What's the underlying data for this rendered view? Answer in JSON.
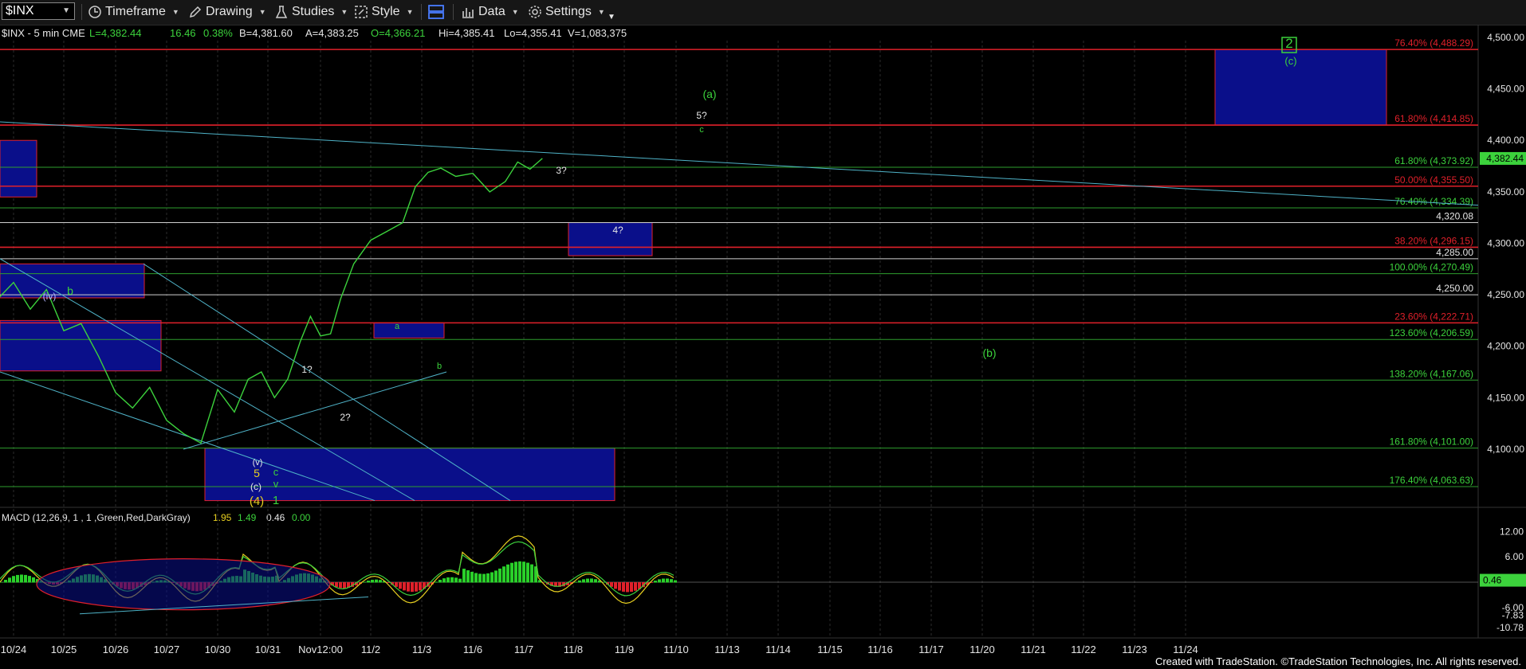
{
  "toolbar": {
    "symbol": "$INX",
    "timeframe": "Timeframe",
    "drawing": "Drawing",
    "studies": "Studies",
    "style": "Style",
    "data": "Data",
    "settings": "Settings"
  },
  "status_line": {
    "name": "$INX - 5 min  CME",
    "last": "L=4,382.44",
    "change": "16.46",
    "change_pct": "0.38%",
    "bid": "B=4,381.60",
    "ask": "A=4,383.25",
    "open": "O=4,366.21",
    "high": "Hi=4,385.41",
    "low": "Lo=4,355.41",
    "volume": "V=1,083,375"
  },
  "macd_legend": {
    "name": "MACD (12,26,9, 1 , 1 ,Green,Red,DarkGray)",
    "v1": "1.95",
    "v2": "1.49",
    "v3": "0.46",
    "v4": "0.00"
  },
  "footer": "Created with TradeStation. ©TradeStation Technologies, Inc. All rights reserved.",
  "chart_data": {
    "type": "line",
    "title": "$INX - 5 min",
    "price_axis": {
      "min": 4050,
      "max": 4500,
      "ticks": [
        "4,100.00",
        "4,150.00",
        "4,200.00",
        "4,250.00",
        "4,300.00",
        "4,350.00",
        "4,400.00",
        "4,450.00",
        "4,500.00"
      ]
    },
    "last_price": "4,382.44",
    "x_labels": [
      "10/24",
      "10/25",
      "10/26",
      "10/27",
      "10/30",
      "10/31",
      "Nov12:00",
      "11/2",
      "11/3",
      "11/6",
      "11/7",
      "11/8",
      "11/9",
      "11/10",
      "11/13",
      "11/14",
      "11/15",
      "11/16",
      "11/17",
      "11/20",
      "11/21",
      "11/22",
      "11/23",
      "11/24"
    ],
    "price_series": [
      [
        "10/24",
        4245
      ],
      [
        "10/24",
        4262
      ],
      [
        "10/24",
        4236
      ],
      [
        "10/25",
        4255
      ],
      [
        "10/25",
        4215
      ],
      [
        "10/25",
        4222
      ],
      [
        "10/26",
        4190
      ],
      [
        "10/26",
        4155
      ],
      [
        "10/26",
        4140
      ],
      [
        "10/27",
        4160
      ],
      [
        "10/27",
        4128
      ],
      [
        "10/27",
        4115
      ],
      [
        "10/30",
        4106
      ],
      [
        "10/30",
        4158
      ],
      [
        "10/30",
        4136
      ],
      [
        "10/31",
        4168
      ],
      [
        "10/31",
        4175
      ],
      [
        "10/31",
        4150
      ],
      [
        "10/31",
        4168
      ],
      [
        "Nov12:00",
        4205
      ],
      [
        "Nov12:00",
        4229
      ],
      [
        "Nov12:00",
        4210
      ],
      [
        "Nov12:00",
        4212
      ],
      [
        "Nov12:00",
        4246
      ],
      [
        "11/2",
        4280
      ],
      [
        "11/2",
        4303
      ],
      [
        "11/2",
        4312
      ],
      [
        "11/3",
        4320
      ],
      [
        "11/3",
        4355
      ],
      [
        "11/3",
        4369
      ],
      [
        "11/3",
        4373
      ],
      [
        "11/6",
        4365
      ],
      [
        "11/6",
        4368
      ],
      [
        "11/6",
        4350
      ],
      [
        "11/7",
        4360
      ],
      [
        "11/7",
        4379
      ],
      [
        "11/7",
        4372
      ],
      [
        "11/7",
        4382.44
      ]
    ],
    "levels": [
      {
        "label": "76.40% (4,488.29)",
        "price": 4488.29,
        "color": "#e0202a",
        "line": "red"
      },
      {
        "label": "61.80% (4,414.85)",
        "price": 4414.85,
        "color": "#e0202a",
        "line": "red"
      },
      {
        "label": "61.80% (4,373.92)",
        "price": 4373.92,
        "color": "#3cd23c",
        "line": "green"
      },
      {
        "label": "50.00% (4,355.50)",
        "price": 4355.5,
        "color": "#e0202a",
        "line": "red"
      },
      {
        "label": "76.40% (4,334.39)",
        "price": 4334.39,
        "color": "#3cd23c",
        "line": "green"
      },
      {
        "label": "4,320.08",
        "price": 4320.08,
        "color": "#e6e6e6",
        "line": "white"
      },
      {
        "label": "38.20% (4,296.15)",
        "price": 4296.15,
        "color": "#e0202a",
        "line": "red"
      },
      {
        "label": "4,285.00",
        "price": 4285.0,
        "color": "#e6e6e6",
        "line": "white"
      },
      {
        "label": "100.00% (4,270.49)",
        "price": 4270.49,
        "color": "#3cd23c",
        "line": "green"
      },
      {
        "label": "4,250.00",
        "price": 4250.0,
        "color": "#e6e6e6",
        "line": "white"
      },
      {
        "label": "23.60% (4,222.71)",
        "price": 4222.71,
        "color": "#e0202a",
        "line": "red"
      },
      {
        "label": "123.60% (4,206.59)",
        "price": 4206.59,
        "color": "#3cd23c",
        "line": "green"
      },
      {
        "label": "138.20% (4,167.06)",
        "price": 4167.06,
        "color": "#3cd23c",
        "line": "green"
      },
      {
        "label": "161.80% (4,101.00)",
        "price": 4101.0,
        "color": "#3cd23c",
        "line": "green"
      },
      {
        "label": "176.40% (4,063.63)",
        "price": 4063.63,
        "color": "#3cd23c",
        "line": "green"
      }
    ],
    "macd": {
      "ticks": [
        "12.00",
        "6.00",
        "0.46",
        "-6.00",
        "-7.83",
        "-10.78"
      ]
    },
    "annotations": [
      "2",
      "(c)",
      "(a)",
      "5?",
      "c",
      "3?",
      "4?",
      "(iv)",
      "b",
      "a",
      "b",
      "1?",
      "2?",
      "(b)",
      "(v)",
      "5",
      "(c)",
      "c",
      "v",
      "(4)",
      "1"
    ]
  }
}
